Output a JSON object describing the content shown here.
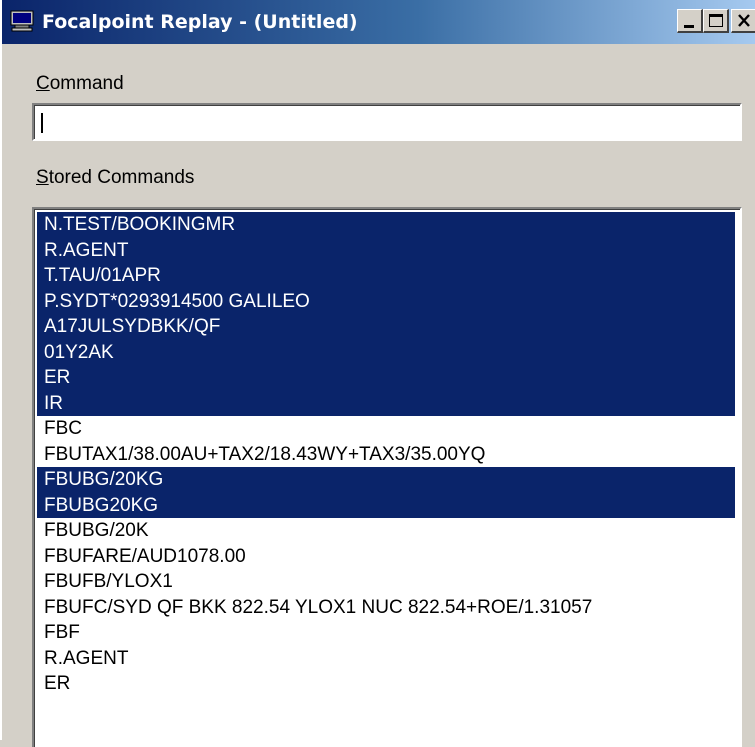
{
  "window": {
    "title": "Focalpoint Replay - (Untitled)",
    "icon": "computer-monitor-icon",
    "title_gradient": [
      "#0a246a",
      "#a6caf0"
    ],
    "buttons": [
      "minimize-icon",
      "maximize-icon",
      "close-icon"
    ]
  },
  "command": {
    "label_access_key": "C",
    "label_rest": "ommand",
    "value": ""
  },
  "stored": {
    "label_access_key": "S",
    "label_rest": "tored Commands",
    "selection_color": "#0a246a",
    "items": [
      {
        "text": "N.TEST/BOOKINGMR",
        "selected": true
      },
      {
        "text": "R.AGENT",
        "selected": true
      },
      {
        "text": "T.TAU/01APR",
        "selected": true
      },
      {
        "text": "P.SYDT*0293914500 GALILEO",
        "selected": true
      },
      {
        "text": "A17JULSYDBKK/QF",
        "selected": true
      },
      {
        "text": "01Y2AK",
        "selected": true
      },
      {
        "text": "ER",
        "selected": true
      },
      {
        "text": "IR",
        "selected": true
      },
      {
        "text": "FBC",
        "selected": false
      },
      {
        "text": "FBUTAX1/38.00AU+TAX2/18.43WY+TAX3/35.00YQ",
        "selected": false
      },
      {
        "text": "FBUBG/20KG",
        "selected": true
      },
      {
        "text": "FBUBG20KG",
        "selected": true
      },
      {
        "text": "FBUBG/20K",
        "selected": false
      },
      {
        "text": "FBUFARE/AUD1078.00",
        "selected": false
      },
      {
        "text": "FBUFB/YLOX1",
        "selected": false
      },
      {
        "text": "FBUFC/SYD QF BKK 822.54 YLOX1 NUC 822.54+ROE/1.31057",
        "selected": false
      },
      {
        "text": "FBF",
        "selected": false
      },
      {
        "text": "R.AGENT",
        "selected": false
      },
      {
        "text": "ER",
        "selected": false
      }
    ]
  }
}
